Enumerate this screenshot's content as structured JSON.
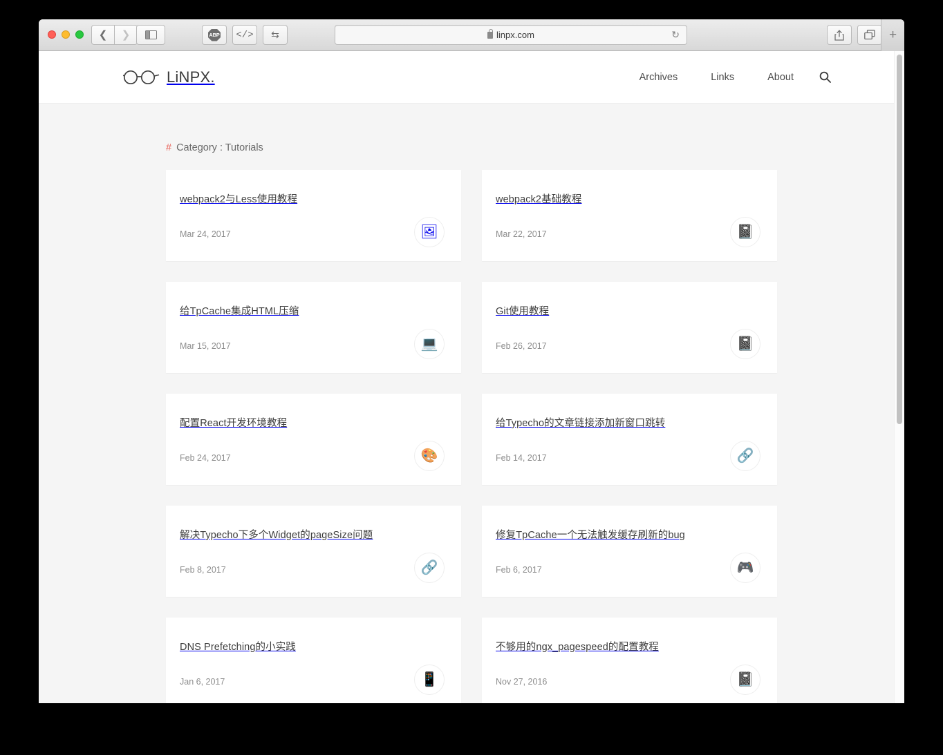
{
  "browser": {
    "url": "linpx.com",
    "lock_icon": "lock-icon",
    "reload_icon": "reload-icon",
    "back_icon": "chevron-left-icon",
    "forward_icon": "chevron-right-icon",
    "sidebar_icon": "sidebar-toggle-icon",
    "abp_label": "ABP",
    "code_label": "</>",
    "sync_icon": "sync-arrows-icon",
    "share_icon": "share-icon",
    "tabs_icon": "show-tabs-icon",
    "newtab_label": "+"
  },
  "site": {
    "logo_text": "LiNPX.",
    "logo_icon": "glasses-icon",
    "nav": [
      {
        "label": "Archives"
      },
      {
        "label": "Links"
      },
      {
        "label": "About"
      }
    ],
    "search_icon": "search-icon"
  },
  "page": {
    "category_hash": "#",
    "category_label": "Category : Tutorials",
    "accent_color": "#e8635a",
    "background_color": "#f5f5f5",
    "card_color": "#ffffff"
  },
  "posts": [
    {
      "title": "webpack2与Less使用教程",
      "date": "Mar 24, 2017",
      "icon": "🖼",
      "icon_name": "windows-picture-icon"
    },
    {
      "title": "webpack2基础教程",
      "date": "Mar 22, 2017",
      "icon": "📓",
      "icon_name": "notebook-icon"
    },
    {
      "title": "给TpCache集成HTML压缩",
      "date": "Mar 15, 2017",
      "icon": "💻",
      "icon_name": "laptop-icon"
    },
    {
      "title": "Git使用教程",
      "date": "Feb 26, 2017",
      "icon": "📓",
      "icon_name": "notebook-icon"
    },
    {
      "title": "配置React开发环境教程",
      "date": "Feb 24, 2017",
      "icon": "🎨",
      "icon_name": "palette-icon"
    },
    {
      "title": "给Typecho的文章链接添加新窗口跳转",
      "date": "Feb 14, 2017",
      "icon": "🔗",
      "icon_name": "link-icon"
    },
    {
      "title": "解决Typecho下多个Widget的pageSize问题",
      "date": "Feb 8, 2017",
      "icon": "🔗",
      "icon_name": "link-icon"
    },
    {
      "title": "修复TpCache一个无法触发缓存刷新的bug",
      "date": "Feb 6, 2017",
      "icon": "🎮",
      "icon_name": "game-controller-icon"
    },
    {
      "title": "DNS Prefetching的小实践",
      "date": "Jan 6, 2017",
      "icon": "📱",
      "icon_name": "devices-icon"
    },
    {
      "title": "不够用的ngx_pagespeed的配置教程",
      "date": "Nov 27, 2016",
      "icon": "📓",
      "icon_name": "notebook-icon"
    }
  ]
}
